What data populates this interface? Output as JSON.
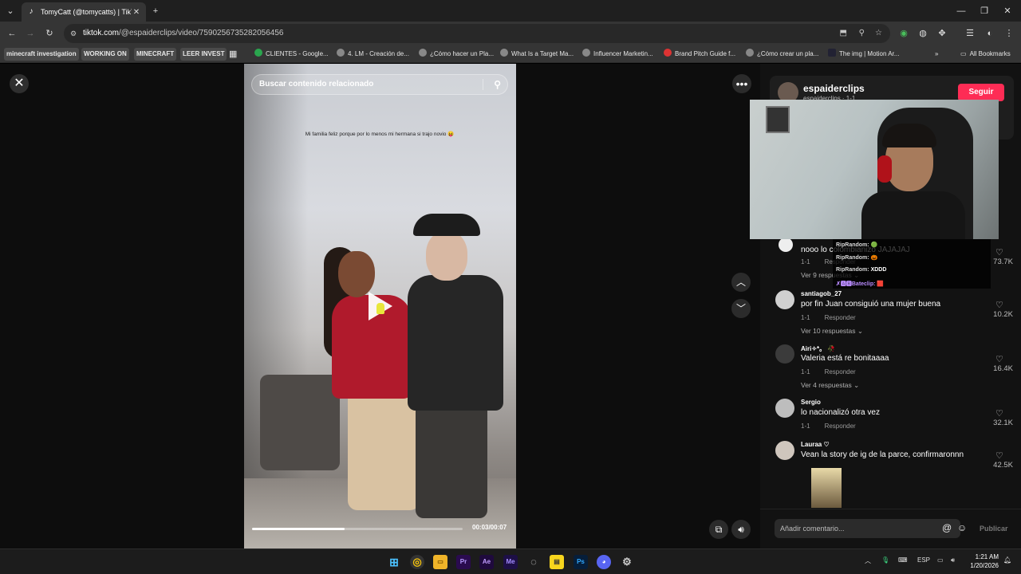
{
  "browser": {
    "tab_title": "TomyCatt (@tomycatts) | TikTok",
    "url_host": "tiktok.com",
    "url_path": "/@espaiderclips/video/7590256735282056456",
    "bookmarks": [
      "minecraft investigation",
      "WORKING ON",
      "MINECRAFT",
      "LEER INVEST",
      "CLIENTES - Google...",
      "4. LM - Creación de...",
      "¿Cómo hacer un Pla...",
      "What Is a Target Ma...",
      "Influencer Marketin...",
      "Brand Pitch Guide f...",
      "¿Cómo crear un pla...",
      "The img | Motion Ar..."
    ],
    "all_bookmarks": "All Bookmarks"
  },
  "video": {
    "search_placeholder": "Buscar contenido relacionado",
    "caption": "Mi familia feliz porque por lo menos mi hermana si trajo novio 😝",
    "time": "00:03/00:07",
    "progress": 0.44
  },
  "author": {
    "name": "espaiderclips",
    "sub": "espaiderclips · 1-1",
    "follow": "Seguir"
  },
  "chat": [
    {
      "user": "RipRandom:",
      "msg": "🟢"
    },
    {
      "user": "RipRandom:",
      "msg": "🎃"
    },
    {
      "user": "RipRandom:",
      "msg": "XDDD"
    },
    {
      "user": "✗🅰🅱Bateclip:",
      "msg": "🟥"
    }
  ],
  "comments": [
    {
      "user": "",
      "text": "nooo lo colombianizó JAJAJAJ",
      "date": "1-1",
      "reply": "Responder",
      "replies": "Ver 9 respuestas ⌄",
      "likes": "73.7K"
    },
    {
      "user": "santiagob_27",
      "text": "por fin Juan consiguió una mujer buena",
      "date": "1-1",
      "reply": "Responder",
      "replies": "Ver 10 respuestas ⌄",
      "likes": "10.2K"
    },
    {
      "user": "Airi✧*。 🥀",
      "text": "Valeria está re bonitaaaa",
      "date": "1-1",
      "reply": "Responder",
      "replies": "Ver 4 respuestas ⌄",
      "likes": "16.4K"
    },
    {
      "user": "Sergio",
      "text": "lo nacionalizó otra vez",
      "date": "1-1",
      "reply": "Responder",
      "replies": "",
      "likes": "32.1K"
    },
    {
      "user": "Lauraa ♡",
      "text": "Vean la story de ig de la parce, confirmaronnn",
      "date": "",
      "reply": "",
      "replies": "",
      "likes": "42.5K"
    }
  ],
  "comment_bar": {
    "placeholder": "Añadir comentario...",
    "publish": "Publicar"
  },
  "taskbar": {
    "lang": "ESP",
    "time": "1:21 AM",
    "date": "1/20/2026",
    "apps": [
      "Pr",
      "Ae",
      "Me",
      "Ps"
    ]
  },
  "colors": {
    "accent": "#fe2c55",
    "background": "#121212"
  }
}
